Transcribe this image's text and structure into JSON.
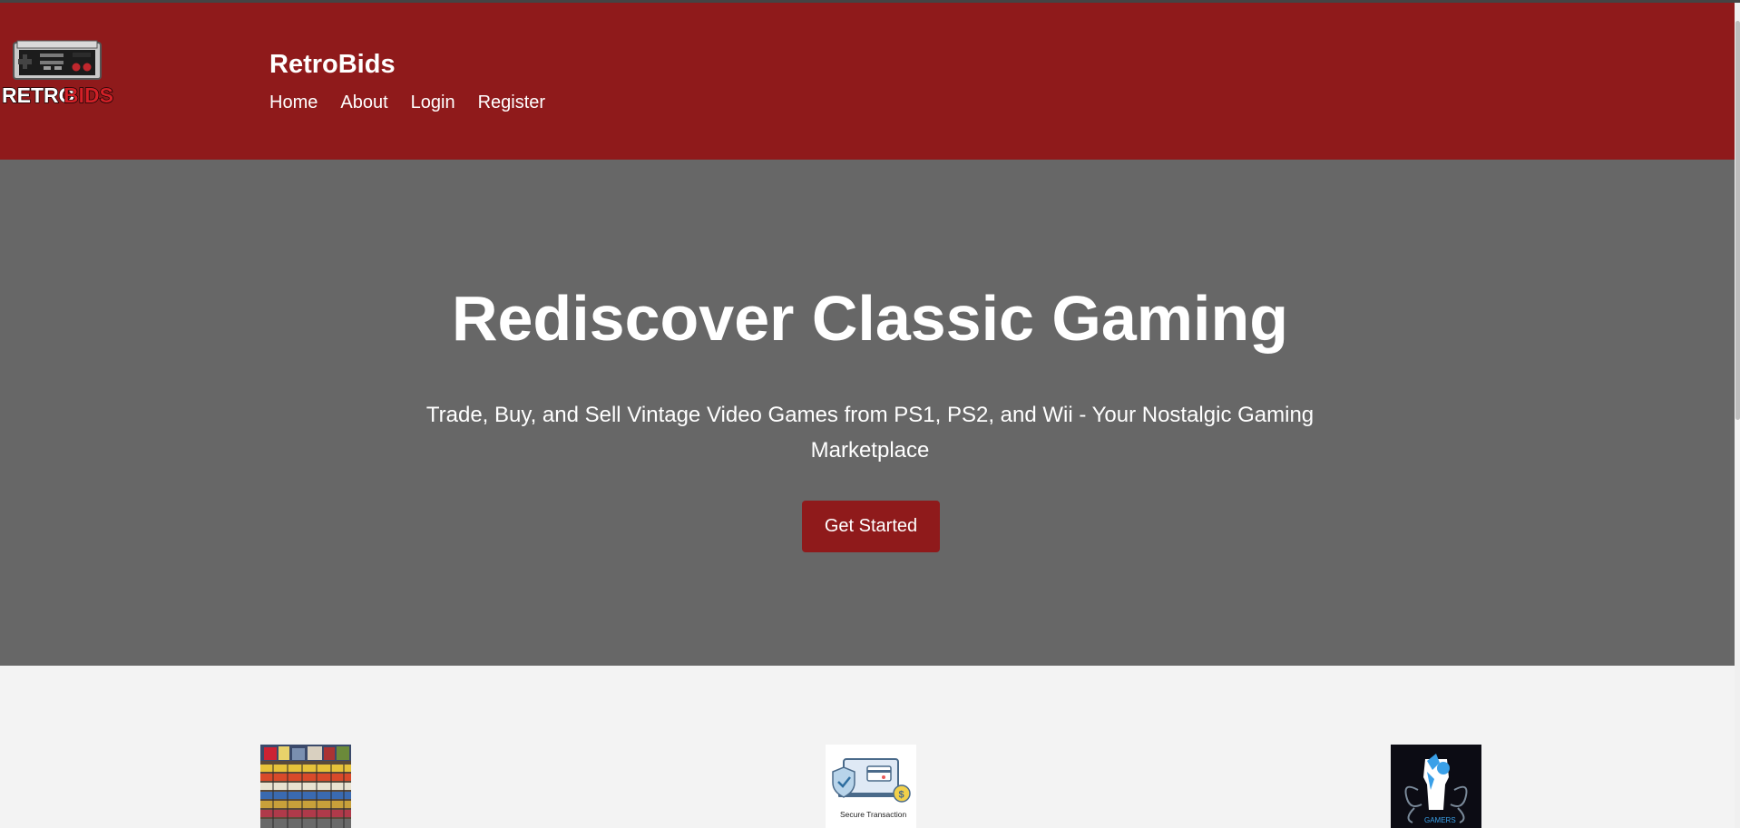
{
  "header": {
    "brand": "RetroBids",
    "logo_text_white": "RETRO",
    "logo_text_red": "BIDS",
    "nav": [
      {
        "label": "Home"
      },
      {
        "label": "About"
      },
      {
        "label": "Login"
      },
      {
        "label": "Register"
      }
    ]
  },
  "hero": {
    "title": "Rediscover Classic Gaming",
    "subtitle": "Trade, Buy, and Sell Vintage Video Games from PS1, PS2, and Wii - Your Nostalgic Gaming Marketplace",
    "cta_label": "Get Started"
  },
  "features": {
    "items": [
      {
        "image": "game-collection-shelf"
      },
      {
        "image": "secure-transaction-laptop",
        "caption": "Secure Transaction"
      },
      {
        "image": "community-fist-emblem",
        "caption": "GAMERS"
      }
    ]
  },
  "colors": {
    "header_bg": "#8f1a1b",
    "hero_bg": "#676767",
    "page_bg": "#f3f3f3",
    "button_bg": "#8f1a1b"
  }
}
